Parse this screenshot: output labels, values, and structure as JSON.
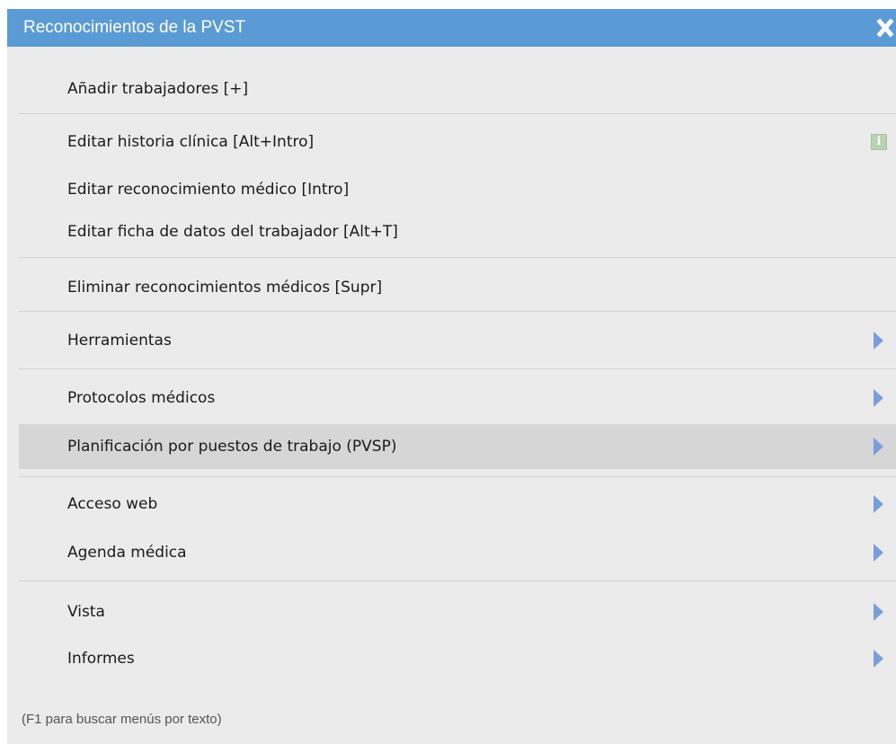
{
  "window": {
    "title": "Reconocimientos de la PVST",
    "close_icon": "close-x-icon"
  },
  "menu": {
    "items": [
      {
        "label": "Añadir trabajadores  [+]"
      },
      {
        "label": "Editar historia clínica  [Alt+Intro]",
        "icon": "info-icon"
      },
      {
        "label": "Editar reconocimiento médico  [Intro]"
      },
      {
        "label": "Editar ficha de datos del trabajador  [Alt+T]"
      },
      {
        "label": "Eliminar reconocimientos médicos  [Supr]"
      },
      {
        "label": "Herramientas",
        "submenu": true
      },
      {
        "label": "Protocolos médicos",
        "submenu": true
      },
      {
        "label": "Planificación por puestos de trabajo (PVSP)",
        "submenu": true,
        "highlighted": true
      },
      {
        "label": "Acceso web",
        "submenu": true
      },
      {
        "label": "Agenda médica",
        "submenu": true
      },
      {
        "label": "Vista",
        "submenu": true
      },
      {
        "label": "Informes",
        "submenu": true
      }
    ]
  },
  "footer": {
    "hint": "(F1 para buscar menús por texto)"
  },
  "colors": {
    "title_bar": "#5b9bd5",
    "panel_bg": "#ebebeb",
    "highlight_bg": "#d6d6d6",
    "submenu_arrow": "#7a9edb"
  }
}
